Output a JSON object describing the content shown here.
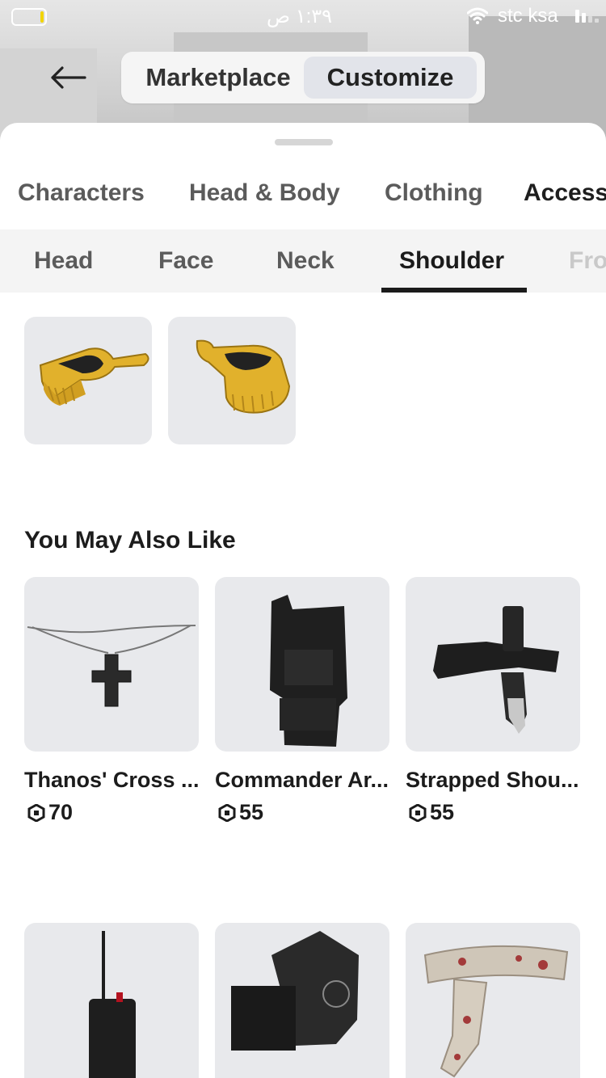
{
  "status_bar": {
    "time": "١:٣٩ ص",
    "carrier": "stc ksa"
  },
  "header": {
    "segments": [
      "Marketplace",
      "Customize"
    ],
    "selected": "Customize"
  },
  "categories": [
    "Characters",
    "Head & Body",
    "Clothing",
    "Access"
  ],
  "subcategories": [
    "Head",
    "Face",
    "Neck",
    "Shoulder",
    "Fro"
  ],
  "active_subcategory": "Shoulder",
  "equipped_items_icons": [
    "gold-epaulette-left-icon",
    "gold-epaulette-right-icon"
  ],
  "recommendations": {
    "title": "You May Also Like",
    "items": [
      {
        "name": "Thanos' Cross ...",
        "price": "70",
        "icon": "cross-necklace-icon"
      },
      {
        "name": "Commander Ar...",
        "price": "55",
        "icon": "armor-icon"
      },
      {
        "name": "Strapped Shou...",
        "price": "55",
        "icon": "knife-strap-icon"
      }
    ],
    "row2_icons": [
      "radio-icon",
      "shoulder-pad-icon",
      "bandage-icon"
    ]
  },
  "colors": {
    "accent_underline": "#1b1b1b",
    "tile_bg": "#e8e9ec",
    "gold": "#e1b12c"
  }
}
